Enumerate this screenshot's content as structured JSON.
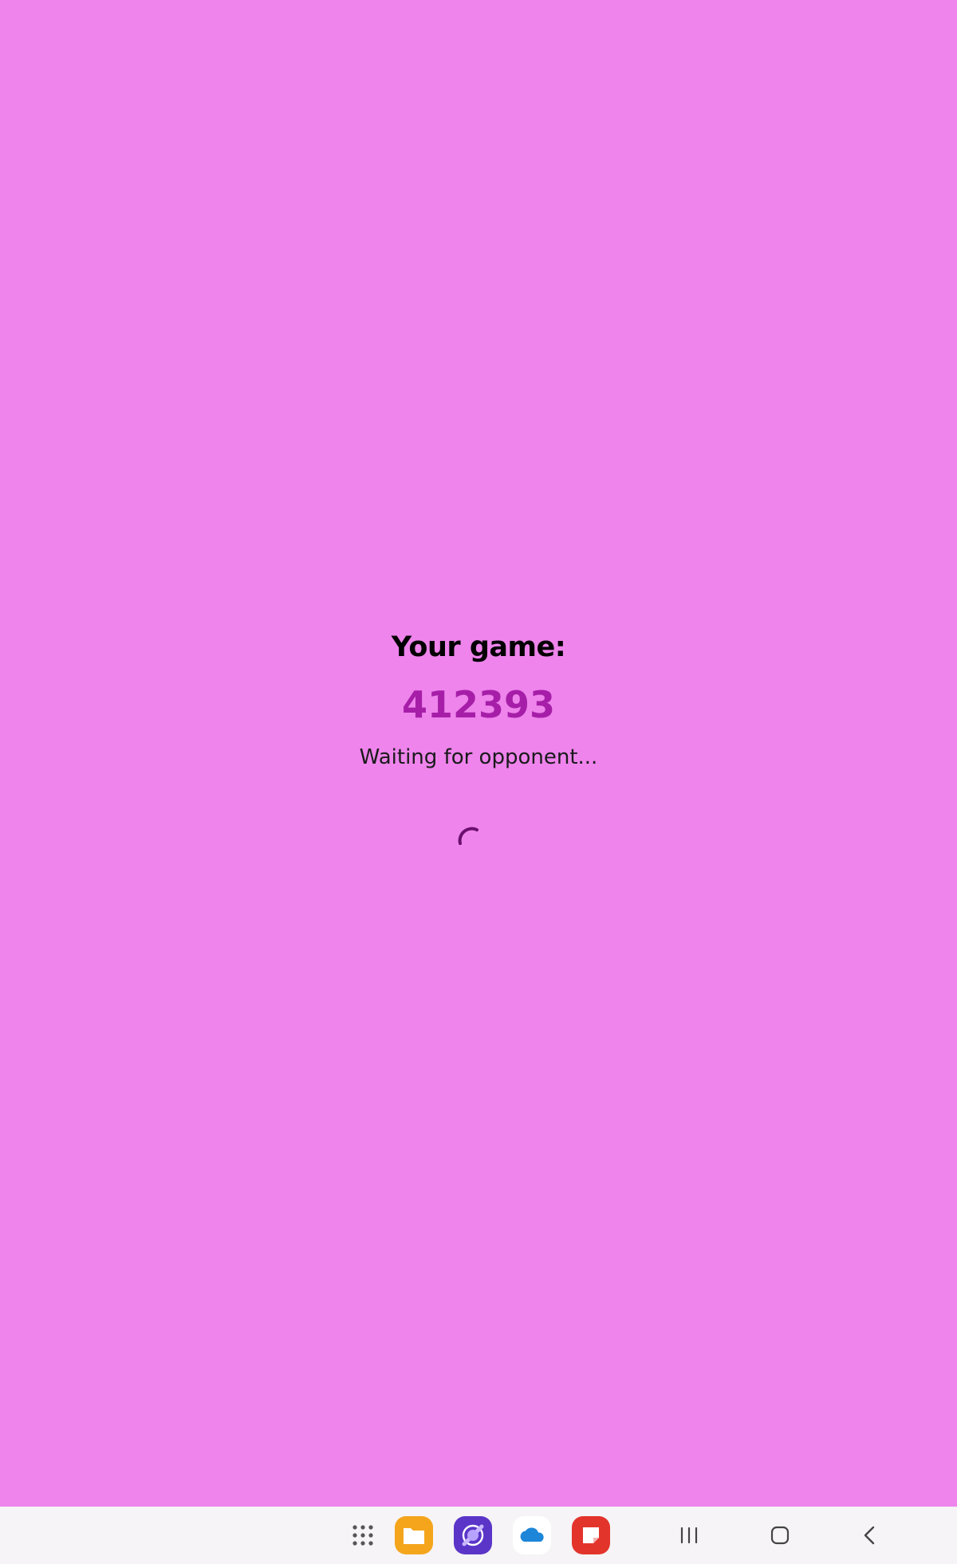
{
  "game": {
    "heading": "Your game:",
    "code": "412393",
    "status": "Waiting for opponent..."
  },
  "colors": {
    "background": "#ee84ec",
    "code": "#a61ea8",
    "spinner": "#6b0f6e",
    "nav_bar": "#f6f4f6"
  },
  "nav_bar": {
    "apps": [
      {
        "icon": "app-drawer-icon"
      },
      {
        "icon": "my-files-icon",
        "color": "#f4a51c"
      },
      {
        "icon": "internet-browser-icon",
        "color": "#5b35c8"
      },
      {
        "icon": "onedrive-icon",
        "color": "#1d86d8"
      },
      {
        "icon": "notes-icon",
        "color": "#e3342b"
      }
    ],
    "system": [
      {
        "icon": "recent-apps-icon"
      },
      {
        "icon": "home-icon"
      },
      {
        "icon": "back-icon"
      }
    ]
  }
}
